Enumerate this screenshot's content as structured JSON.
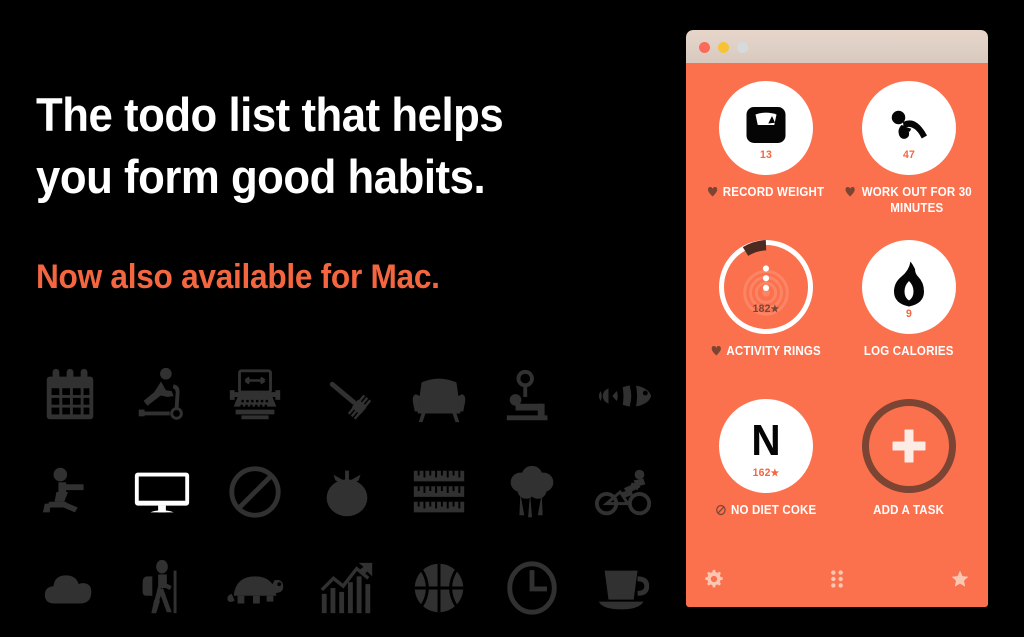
{
  "marketing": {
    "headline": "The todo list that helps\nyou form good habits.",
    "subheadline": "Now also available for Mac.",
    "headline_color": "#ffffff",
    "subheadline_color": "#f4663f",
    "background_color": "#000000"
  },
  "icon_grid": {
    "icon_color": "#313131",
    "highlight_color": "#ffffff",
    "items": [
      {
        "name": "calendar-icon",
        "highlighted": false
      },
      {
        "name": "scooter-icon",
        "highlighted": false
      },
      {
        "name": "typewriter-icon",
        "highlighted": false
      },
      {
        "name": "toothbrush-icon",
        "highlighted": false
      },
      {
        "name": "armchair-icon",
        "highlighted": false
      },
      {
        "name": "bench-press-icon",
        "highlighted": false
      },
      {
        "name": "clownfish-icon",
        "highlighted": false
      },
      {
        "name": "stretching-person-icon",
        "highlighted": false
      },
      {
        "name": "monitor-icon",
        "highlighted": true
      },
      {
        "name": "prohibition-icon",
        "highlighted": false
      },
      {
        "name": "tomato-icon",
        "highlighted": false
      },
      {
        "name": "measuring-tape-icon",
        "highlighted": false
      },
      {
        "name": "broccoli-icon",
        "highlighted": false
      },
      {
        "name": "bicycle-icon",
        "highlighted": false
      },
      {
        "name": "cloud-icon",
        "highlighted": false
      },
      {
        "name": "hiker-icon",
        "highlighted": false
      },
      {
        "name": "turtle-icon",
        "highlighted": false
      },
      {
        "name": "growth-chart-icon",
        "highlighted": false
      },
      {
        "name": "basketball-icon",
        "highlighted": false
      },
      {
        "name": "clock-icon",
        "highlighted": false
      },
      {
        "name": "coffee-cup-icon",
        "highlighted": false
      }
    ]
  },
  "app": {
    "accent_color": "#fb714e",
    "dark_brown": "#7b4433",
    "count_color": "#f4663f",
    "titlebar": {
      "buttons": [
        {
          "name": "close-button",
          "color": "#fb6a5b"
        },
        {
          "name": "minimize-button",
          "color": "#f7c331"
        },
        {
          "name": "zoom-button",
          "color": "#d6dadb"
        }
      ]
    },
    "habits": [
      {
        "label": "Record Weight",
        "count": "13",
        "star": "",
        "icon": "bathroom-scale-icon",
        "label_icon": "heart-icon",
        "style": "filled"
      },
      {
        "label": "Work out for 30 minutes",
        "count": "47",
        "star": "",
        "icon": "sit-up-icon",
        "label_icon": "heart-icon",
        "style": "filled"
      },
      {
        "label": "Activity Rings",
        "count": "182",
        "star": "★",
        "icon": "activity-rings-icon",
        "label_icon": "heart-icon",
        "style": "ring",
        "progress_percent": 14
      },
      {
        "label": "Log Calories",
        "count": "9",
        "star": "",
        "icon": "flame-icon",
        "label_icon": "",
        "style": "filled"
      },
      {
        "label": "No Diet Coke",
        "count": "162",
        "star": "★",
        "icon": "letter-n-icon",
        "icon_letter": "N",
        "label_icon": "prohibition-icon",
        "style": "filled"
      },
      {
        "label": "Add a task",
        "count": "",
        "star": "",
        "icon": "plus-icon",
        "label_icon": "",
        "style": "add"
      }
    ],
    "toolbar": [
      {
        "name": "settings-button",
        "icon": "gear-icon"
      },
      {
        "name": "grid-view-button",
        "icon": "grid-dots-icon"
      },
      {
        "name": "favorites-button",
        "icon": "star-icon"
      }
    ]
  }
}
